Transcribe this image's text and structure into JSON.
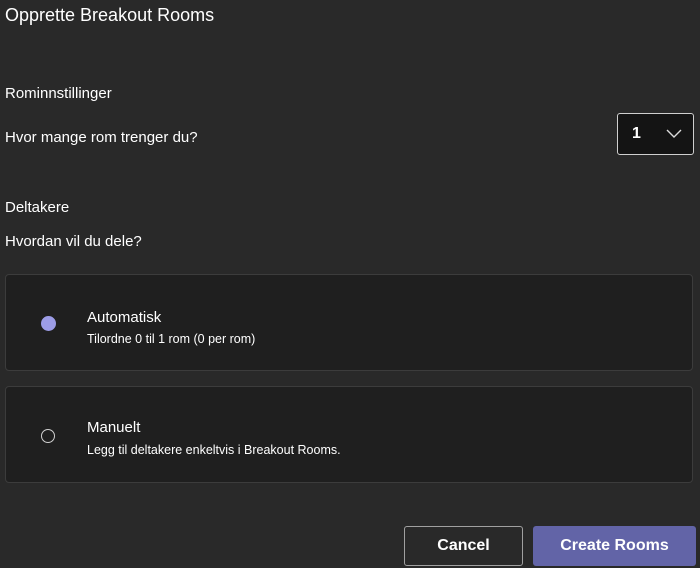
{
  "dialog": {
    "title": "Opprette Breakout Rooms"
  },
  "room_settings": {
    "section_label": "Rominnstillinger",
    "question": "Hvor mange rom trenger du?",
    "room_count_value": "1",
    "dropdown_icon": "chevron-down-icon"
  },
  "participants": {
    "section_label": "Deltakere",
    "question": "Hvordan vil du dele?",
    "options": [
      {
        "title": "Automatisk",
        "description": "Tilordne 0 til 1 rom (0 per rom)",
        "selected": true
      },
      {
        "title": "Manuelt",
        "description": "Legg til deltakere enkeltvis i Breakout Rooms.",
        "selected": false
      }
    ]
  },
  "footer": {
    "cancel_label": "Cancel",
    "create_label": "Create Rooms"
  },
  "colors": {
    "background": "#292929",
    "card_background": "#1f1f1f",
    "accent": "#6264a7",
    "radio_selected": "#9c9ce6"
  }
}
